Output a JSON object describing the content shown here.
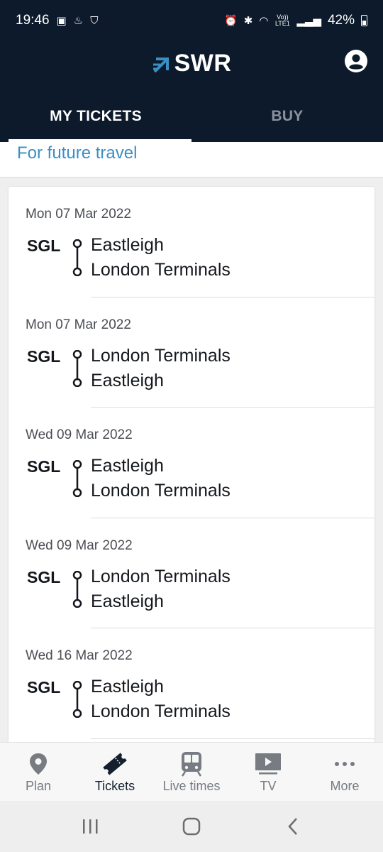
{
  "status_bar": {
    "time": "19:46",
    "network": "Vo)) LTE1",
    "battery": "42%"
  },
  "header": {
    "logo_text": "SWR",
    "tabs": [
      {
        "label": "MY TICKETS",
        "active": true
      },
      {
        "label": "BUY",
        "active": false
      }
    ]
  },
  "section": {
    "title": "For future travel"
  },
  "tickets": [
    {
      "date": "Mon 07 Mar 2022",
      "type": "SGL",
      "from": "Eastleigh",
      "to": "London Terminals"
    },
    {
      "date": "Mon 07 Mar 2022",
      "type": "SGL",
      "from": "London Terminals",
      "to": "Eastleigh"
    },
    {
      "date": "Wed 09 Mar 2022",
      "type": "SGL",
      "from": "Eastleigh",
      "to": "London Terminals"
    },
    {
      "date": "Wed 09 Mar 2022",
      "type": "SGL",
      "from": "London Terminals",
      "to": "Eastleigh"
    },
    {
      "date": "Wed 16 Mar 2022",
      "type": "SGL",
      "from": "Eastleigh",
      "to": "London Terminals"
    }
  ],
  "bottom_nav": [
    {
      "label": "Plan",
      "icon": "location-pin-icon",
      "active": false
    },
    {
      "label": "Tickets",
      "icon": "ticket-icon",
      "active": true
    },
    {
      "label": "Live times",
      "icon": "train-icon",
      "active": false
    },
    {
      "label": "TV",
      "icon": "tv-icon",
      "active": false
    },
    {
      "label": "More",
      "icon": "more-dots-icon",
      "active": false
    }
  ],
  "colors": {
    "header_bg": "#0d1a2b",
    "accent_blue": "#3a8fc5",
    "text_dark": "#14171c",
    "nav_inactive": "#777b82"
  }
}
